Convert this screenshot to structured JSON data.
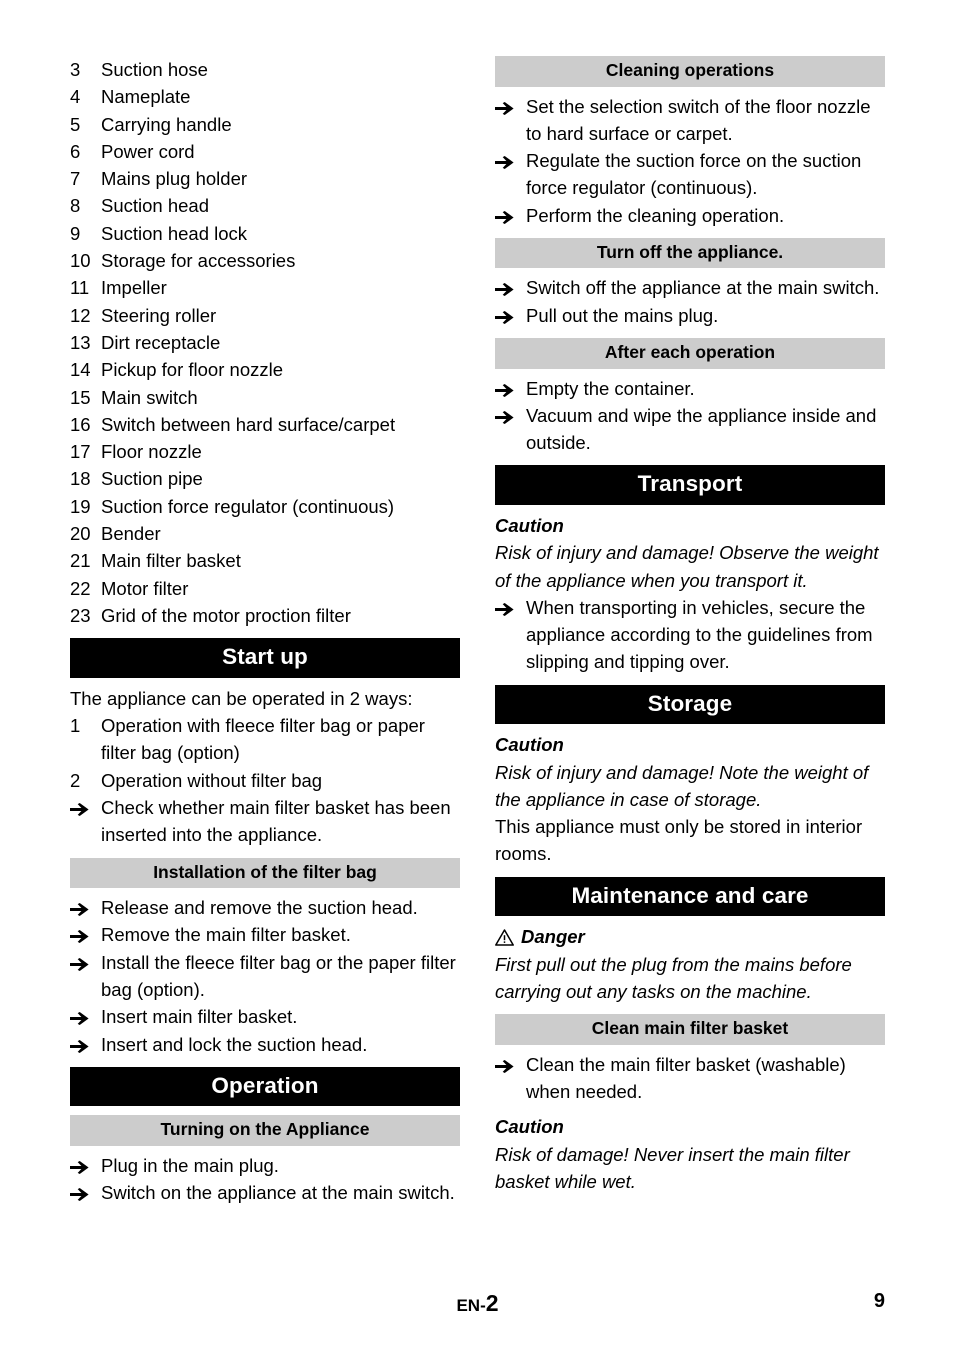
{
  "document": {
    "footer": {
      "language_code": "EN",
      "separator": "-",
      "section_page": "2",
      "book_page": "9"
    }
  },
  "left_column": {
    "parts_list": [
      {
        "num": "3",
        "label": "Suction hose"
      },
      {
        "num": "4",
        "label": "Nameplate"
      },
      {
        "num": "5",
        "label": "Carrying handle"
      },
      {
        "num": "6",
        "label": "Power cord"
      },
      {
        "num": "7",
        "label": "Mains plug holder"
      },
      {
        "num": "8",
        "label": "Suction head"
      },
      {
        "num": "9",
        "label": "Suction head lock"
      },
      {
        "num": "10",
        "label": "Storage for accessories"
      },
      {
        "num": "11",
        "label": "Impeller"
      },
      {
        "num": "12",
        "label": "Steering roller"
      },
      {
        "num": "13",
        "label": "Dirt receptacle"
      },
      {
        "num": "14",
        "label": "Pickup for floor nozzle"
      },
      {
        "num": "15",
        "label": "Main switch"
      },
      {
        "num": "16",
        "label": "Switch between hard surface/carpet"
      },
      {
        "num": "17",
        "label": "Floor nozzle"
      },
      {
        "num": "18",
        "label": "Suction pipe"
      },
      {
        "num": "19",
        "label": "Suction force regulator (continuous)"
      },
      {
        "num": "20",
        "label": "Bender"
      },
      {
        "num": "21",
        "label": "Main filter basket"
      },
      {
        "num": "22",
        "label": "Motor filter"
      },
      {
        "num": "23",
        "label": "Grid of the motor proction filter"
      }
    ],
    "start_up": {
      "heading": "Start up",
      "intro": "The appliance can be operated in 2 ways:",
      "numbered": [
        {
          "num": "1",
          "label": "Operation with fleece filter bag or paper filter bag (option)"
        },
        {
          "num": "2",
          "label": "Operation without filter bag"
        }
      ],
      "steps": [
        "Check whether main filter basket has been inserted into the appliance."
      ]
    },
    "filter_bag": {
      "heading": "Installation of the filter bag",
      "steps": [
        "Release and remove the suction head.",
        "Remove the main filter basket.",
        "Install the fleece filter bag or the paper filter bag (option).",
        "Insert main filter basket.",
        "Insert and lock the suction head."
      ]
    },
    "operation": {
      "heading": "Operation"
    },
    "turning_on": {
      "heading": "Turning on the Appliance",
      "steps": [
        "Plug in the main plug.",
        "Switch on the appliance at the main switch."
      ]
    }
  },
  "right_column": {
    "cleaning_operations": {
      "heading": "Cleaning operations",
      "steps": [
        "Set the selection switch of the floor nozzle to hard surface or carpet.",
        "Regulate the suction force on the suction force regulator (continuous).",
        "Perform the cleaning operation."
      ]
    },
    "turn_off": {
      "heading": "Turn off the appliance.",
      "steps": [
        "Switch off the appliance at the main switch.",
        "Pull out the mains plug."
      ]
    },
    "after_each_operation": {
      "heading": "After each operation",
      "steps": [
        "Empty the container.",
        "Vacuum and wipe the appliance inside and outside."
      ]
    },
    "transport": {
      "heading": "Transport",
      "caution_label": "Caution",
      "caution_text": "Risk of injury and damage! Observe the weight of the appliance when you transport it.",
      "steps": [
        "When transporting in vehicles, secure the appliance according to the guidelines from slipping and tipping over."
      ]
    },
    "storage": {
      "heading": "Storage",
      "caution_label": "Caution",
      "caution_text": "Risk of injury and damage! Note the weight of the appliance in case of storage.",
      "body": "This appliance must only be stored in interior rooms."
    },
    "maintenance": {
      "heading": "Maintenance and care",
      "danger_label": "Danger",
      "danger_text": "First pull out the plug from the mains before carrying out any tasks on the machine.",
      "clean_basket": {
        "heading": "Clean main filter basket",
        "steps": [
          "Clean the main filter basket (washable) when needed."
        ],
        "caution_label": "Caution",
        "caution_text": "Risk of damage! Never insert the main filter basket while wet."
      }
    }
  }
}
